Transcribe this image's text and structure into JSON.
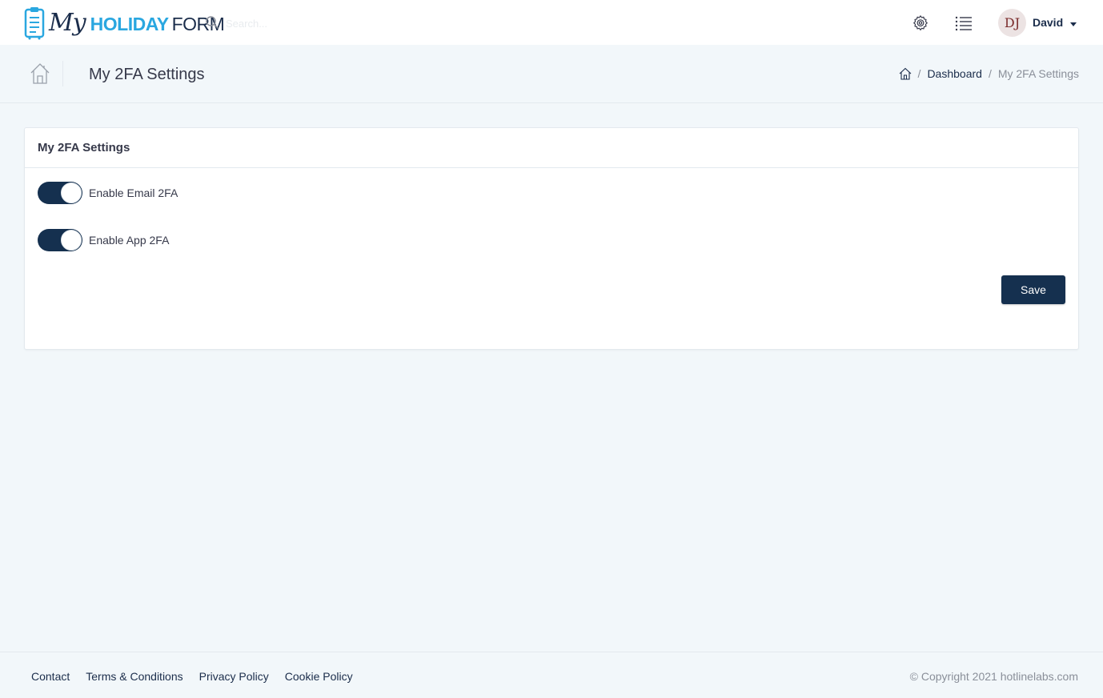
{
  "header": {
    "logo": {
      "part1": "My",
      "part2": "HOLIDAY",
      "part3": "FORM"
    },
    "search": {
      "placeholder": "Search..."
    },
    "icons": {
      "search": "search-icon",
      "settings": "gear-icon",
      "menu": "list-icon"
    },
    "user": {
      "initials": "DJ",
      "name": "David"
    }
  },
  "page": {
    "title": "My 2FA Settings",
    "breadcrumb": {
      "home_icon": "home-icon",
      "dashboard": "Dashboard",
      "sep": "/",
      "current": "My 2FA Settings"
    }
  },
  "card": {
    "title": "My 2FA Settings",
    "toggles": [
      {
        "label": "Enable Email 2FA",
        "enabled": true
      },
      {
        "label": "Enable App 2FA",
        "enabled": true
      }
    ],
    "save_label": "Save"
  },
  "footer": {
    "links": [
      "Contact",
      "Terms & Conditions",
      "Privacy Policy",
      "Cookie Policy"
    ],
    "copyright": "© Copyright 2021 hotlinelabs.com"
  },
  "colors": {
    "primary": "#15304f",
    "accent": "#2aa7e0",
    "background": "#f2f7fa",
    "muted": "#8a8f99"
  }
}
